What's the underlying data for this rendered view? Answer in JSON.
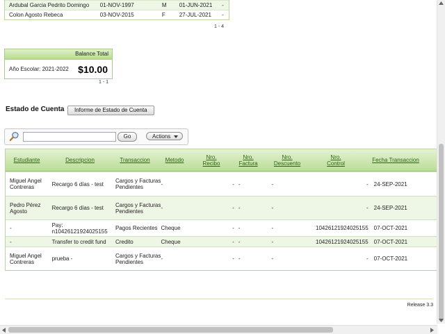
{
  "students": [
    {
      "name": "Ardubal Garcia Pedrito Domingo",
      "birth": "01-NOV-1997",
      "sex": "M",
      "date": "01-JUN-2021",
      "dash": "-"
    },
    {
      "name": "Colon Agosto Rebeca",
      "birth": "03-NOV-2015",
      "sex": "F",
      "date": "27-JUL-2021",
      "dash": "-"
    }
  ],
  "students_pager": "1 - 4",
  "balance": {
    "header": "Balance Total",
    "year": "Año Escolar: 2021-2022",
    "amount": "$10.00",
    "pager": "1 - 1"
  },
  "estado": {
    "title": "Estado de Cuenta",
    "report_button": "Informe de Estado de Cuenta"
  },
  "toolbar": {
    "go": "Go",
    "actions": "Actions",
    "search_value": ""
  },
  "table": {
    "headers": [
      "Estudiante",
      "Descripcion",
      "Transaccion",
      "Metodo",
      "Nro.\nRecibo",
      "Nro.\nFactura",
      "Nro.\nDescuento",
      "Nro.\nControl",
      "Fecha Transaccion"
    ],
    "rows": [
      {
        "estudiante": "Miguel Angel Contreras",
        "descripcion": "Recargo 6 días - test",
        "transaccion": "Cargos y Facturas Pendientes",
        "metodo": "-",
        "recibo": "-",
        "factura": "-",
        "descuento": "-",
        "control": "-",
        "fecha": "24-SEP-2021"
      },
      {
        "estudiante": "Pedro Pérez Agosto",
        "descripcion": "Recargo 6 días - test",
        "transaccion": "Cargos y Facturas Pendientes",
        "metodo": "-",
        "recibo": "-",
        "factura": "-",
        "descuento": "-",
        "control": "-",
        "fecha": "24-SEP-2021"
      },
      {
        "estudiante": "-",
        "descripcion": "Pay: n10426121924025155",
        "transaccion": "Pagos Recientes",
        "metodo": "Cheque",
        "recibo": "-",
        "factura": "-",
        "descuento": "-",
        "control": "10426121924025155",
        "fecha": "07-OCT-2021"
      },
      {
        "estudiante": "-",
        "descripcion": "Transfer to credit fund",
        "transaccion": "Credito",
        "metodo": "Cheque",
        "recibo": "-",
        "factura": "-",
        "descuento": "-",
        "control": "10426121924025155",
        "fecha": "07-OCT-2021"
      },
      {
        "estudiante": "Miguel Angel Contreras",
        "descripcion": "prueba -",
        "transaccion": "Cargos y Facturas Pendientes",
        "metodo": "-",
        "recibo": "-",
        "factura": "-",
        "descuento": "-",
        "control": "-",
        "fecha": "07-OCT-2021"
      }
    ]
  },
  "release": "Release 3.3"
}
